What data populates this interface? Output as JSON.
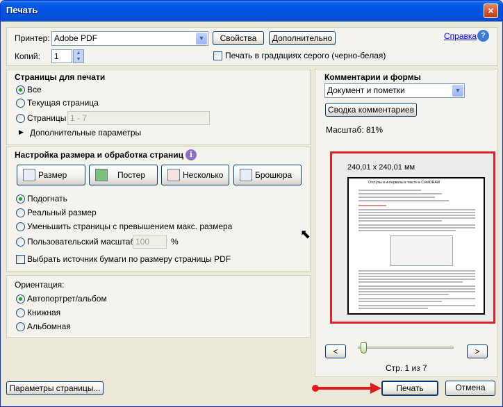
{
  "window": {
    "title": "Печать",
    "close_glyph": "×"
  },
  "printer": {
    "label": "Принтер:",
    "value": "Adobe PDF",
    "properties_button": "Свойства",
    "advanced_button": "Дополнительно",
    "help_link": "Справка",
    "help_icon": "question-icon"
  },
  "copies": {
    "label": "Копий:",
    "value": "1",
    "grayscale_label": "Печать в градациях серого (черно-белая)",
    "grayscale_checked": false
  },
  "pages_section": {
    "title": "Страницы для печати",
    "options": [
      {
        "label": "Все",
        "selected": true
      },
      {
        "label": "Текущая страница",
        "selected": false
      },
      {
        "label": "Страницы",
        "selected": false
      }
    ],
    "range_value": "1 - 7",
    "more_options": "Дополнительные параметры"
  },
  "sizing_section": {
    "title": "Настройка размера и обработка страниц",
    "info_icon": "info-icon",
    "buttons": [
      {
        "label": "Размер"
      },
      {
        "label": "Постер"
      },
      {
        "label": "Несколько"
      },
      {
        "label": "Брошюра"
      }
    ],
    "options": [
      {
        "label": "Подогнать",
        "selected": true
      },
      {
        "label": "Реальный размер",
        "selected": false
      },
      {
        "label": "Уменьшить страницы с превышением макс. размера",
        "selected": false
      },
      {
        "label": "Пользовательский масштаб:",
        "selected": false
      }
    ],
    "scale_value": "100",
    "scale_unit": "%",
    "paper_source_label": "Выбрать источник бумаги по размеру страницы PDF",
    "paper_source_checked": false
  },
  "orientation_section": {
    "title": "Ориентация:",
    "options": [
      {
        "label": "Автопортрет/альбом",
        "selected": true
      },
      {
        "label": "Книжная",
        "selected": false
      },
      {
        "label": "Альбомная",
        "selected": false
      }
    ]
  },
  "comments_section": {
    "title": "Комментарии и формы",
    "value": "Документ и пометки",
    "summary_button": "Сводка комментариев",
    "scale_text": "Масштаб:  81%"
  },
  "preview": {
    "page_size": "240,01 x 240,01 мм",
    "doc_title": "Отступы и интервалы в тексте в CorelDRAW",
    "highlight_color": "#e0202a",
    "prev_button": "<",
    "next_button": ">",
    "zoom_level": 0.03,
    "page_indicator": "Стр. 1 из 7"
  },
  "footer": {
    "page_setup_button": "Параметры страницы...",
    "print_button": "Печать",
    "cancel_button": "Отмена",
    "arrow_color": "#e51919"
  }
}
